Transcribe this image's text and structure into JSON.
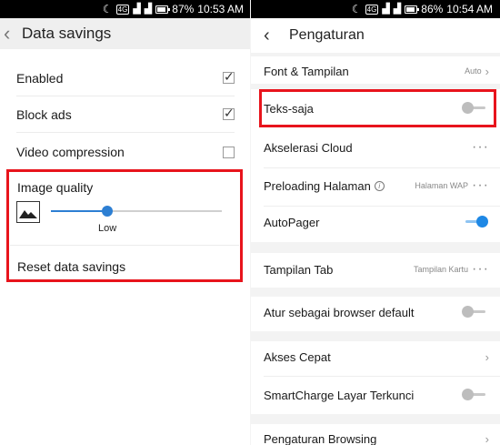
{
  "left": {
    "status": {
      "network": "4G",
      "battery": "87%",
      "time": "10:53 AM"
    },
    "header": {
      "title": "Data savings"
    },
    "rows": [
      {
        "label": "Enabled",
        "checked": true
      },
      {
        "label": "Block ads",
        "checked": true
      },
      {
        "label": "Video compression",
        "checked": false
      }
    ],
    "image_quality": {
      "title": "Image quality",
      "slider_label": "Low",
      "slider_value": 0.33
    },
    "reset_label": "Reset data savings"
  },
  "right": {
    "status": {
      "network": "4G",
      "battery": "86%",
      "time": "10:54 AM"
    },
    "header": {
      "title": "Pengaturan"
    },
    "items": [
      {
        "label": "Font & Tampilan",
        "value": "Auto",
        "control": "chevron"
      },
      {
        "label": "Teks-saja",
        "value": "",
        "control": "toggle",
        "on": false
      },
      {
        "label": "Akselerasi Cloud",
        "value": "",
        "control": "dots"
      },
      {
        "label": "Preloading Halaman",
        "value": "Halaman WAP",
        "control": "dots"
      },
      {
        "label": "AutoPager",
        "value": "",
        "control": "toggle",
        "on": true
      },
      {
        "label": "Tampilan Tab",
        "value": "Tampilan Kartu",
        "control": "dots"
      },
      {
        "label": "Atur sebagai browser default",
        "value": "",
        "control": "toggle",
        "on": false
      },
      {
        "label": "Akses Cepat",
        "value": "",
        "control": "chevron"
      },
      {
        "label": "SmartCharge Layar Terkunci",
        "value": "",
        "control": "toggle",
        "on": false
      },
      {
        "label": "Pengaturan Browsing",
        "value": "",
        "control": "chevron"
      }
    ]
  },
  "colors": {
    "accent": "#1e88e5",
    "highlight": "#e8141c",
    "status_bar": "#000000"
  }
}
